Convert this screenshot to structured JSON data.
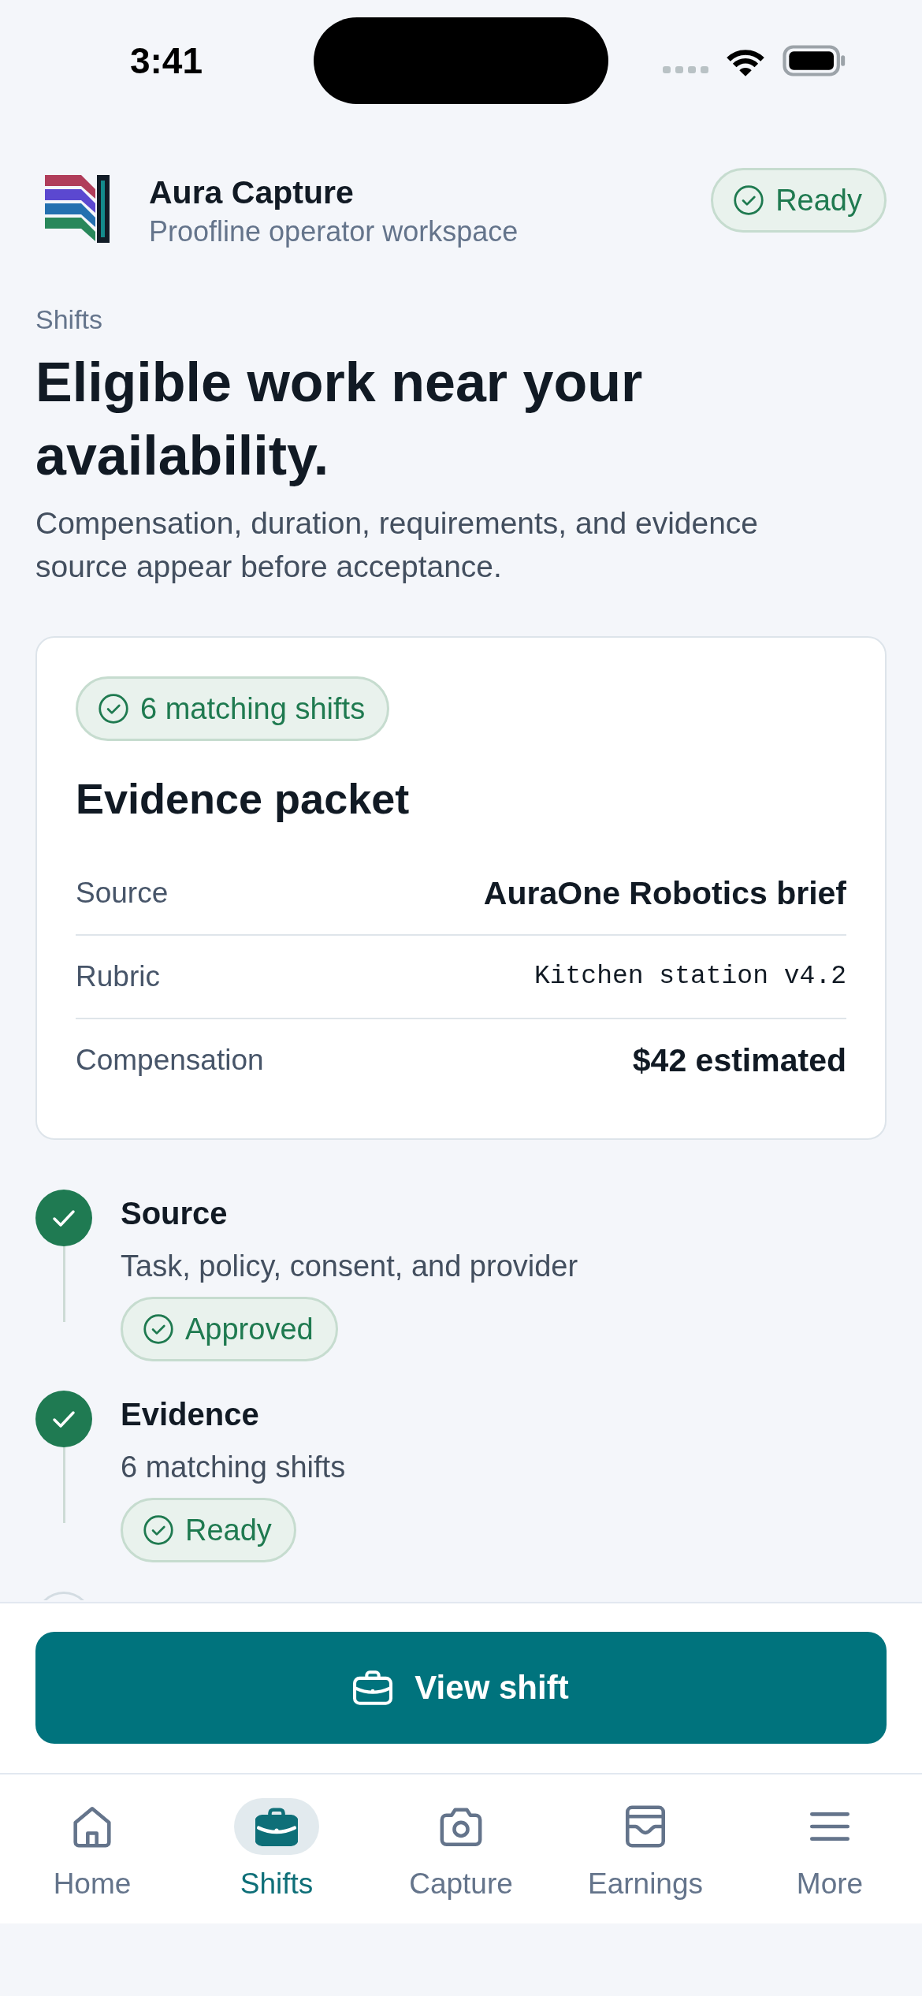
{
  "status_bar": {
    "time": "3:41"
  },
  "header": {
    "app_name": "Aura Capture",
    "subtitle": "Proofline operator workspace",
    "status": "Ready"
  },
  "intro": {
    "eyebrow": "Shifts",
    "title": "Eligible work near your availability.",
    "description": "Compensation, duration, requirements, and evidence source appear before acceptance."
  },
  "evidence_card": {
    "badge": "6 matching shifts",
    "title": "Evidence packet",
    "rows": [
      {
        "label": "Source",
        "value": "AuraOne Robotics brief",
        "kind": "text"
      },
      {
        "label": "Rubric",
        "value": "Kitchen station v4.2",
        "kind": "code"
      },
      {
        "label": "Compensation",
        "value": "$42 estimated",
        "kind": "text"
      }
    ]
  },
  "steps": [
    {
      "title": "Source",
      "description": "Task, policy, consent, and provider",
      "status": "Approved",
      "done": true
    },
    {
      "title": "Evidence",
      "description": "6 matching shifts",
      "status": "Ready",
      "done": true
    },
    {
      "done": false
    }
  ],
  "primary_action": {
    "label": "View shift"
  },
  "tab_bar": {
    "tabs": [
      {
        "label": "Home",
        "selected": false
      },
      {
        "label": "Shifts",
        "selected": true
      },
      {
        "label": "Capture",
        "selected": false
      },
      {
        "label": "Earnings",
        "selected": false
      },
      {
        "label": "More",
        "selected": false
      }
    ]
  }
}
